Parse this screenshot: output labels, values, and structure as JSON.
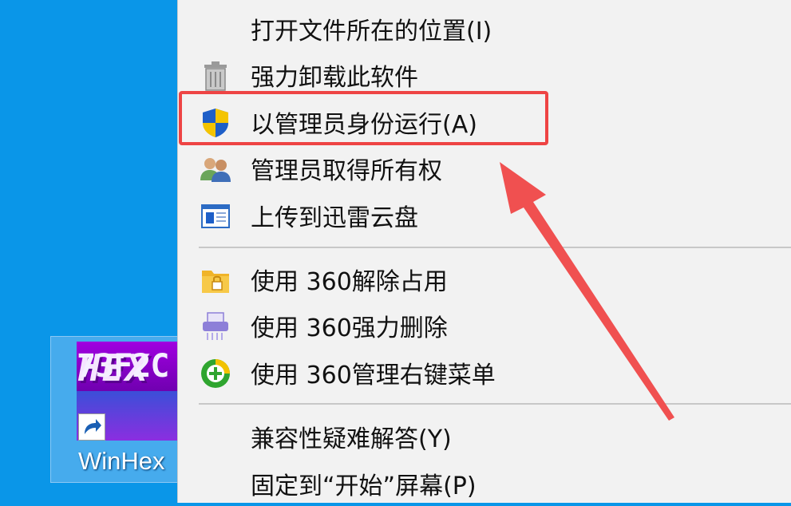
{
  "desktop": {
    "icon_label": "WinHex",
    "logo_top_text": "HEX",
    "logo_bottom_text": "73F2C"
  },
  "menu": {
    "items": [
      {
        "label": "打开文件所在的位置(I)",
        "icon": "none"
      },
      {
        "label": "强力卸载此软件",
        "icon": "trash-can-icon"
      },
      {
        "label": "以管理员身份运行(A)",
        "icon": "uac-shield-icon"
      },
      {
        "label": "管理员取得所有权",
        "icon": "users-icon"
      },
      {
        "label": "上传到迅雷云盘",
        "icon": "window-icon"
      },
      {
        "label": "使用 360解除占用",
        "icon": "folder-lock-icon"
      },
      {
        "label": "使用 360强力删除",
        "icon": "shredder-icon"
      },
      {
        "label": "使用 360管理右键菜单",
        "icon": "plus-circle-icon"
      },
      {
        "label": "兼容性疑难解答(Y)",
        "icon": "none"
      },
      {
        "label": "固定到“开始”屏幕(P)",
        "icon": "none"
      }
    ]
  },
  "annotation": {
    "highlight_color": "#ee4444",
    "highlighted_item": "以管理员身份运行(A)"
  }
}
